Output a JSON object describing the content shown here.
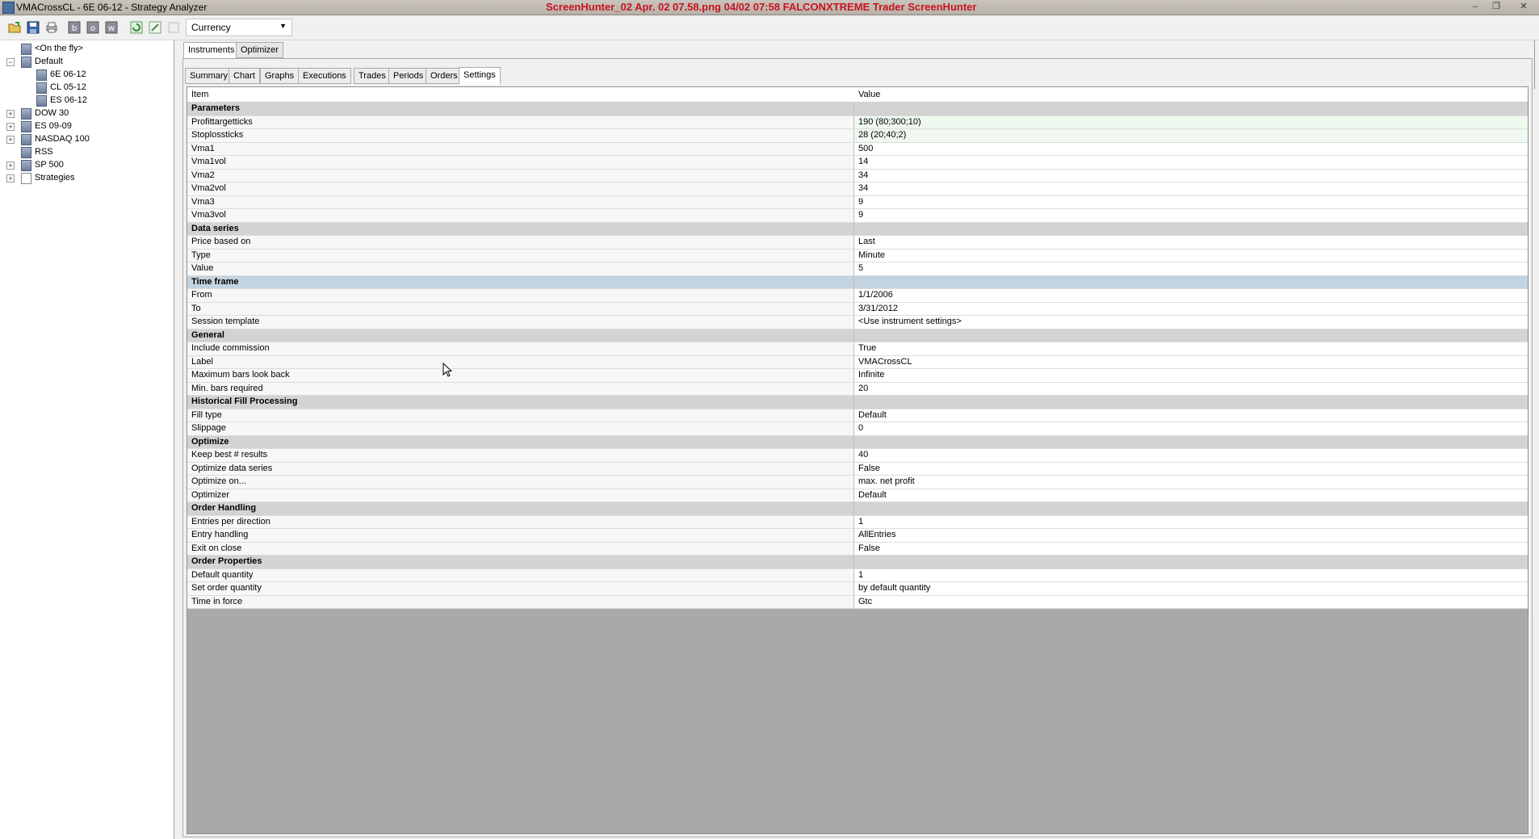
{
  "titlebar": {
    "title": "VMACrossCL - 6E 06-12 - Strategy Analyzer",
    "center_text": "ScreenHunter_02 Apr. 02 07.58.png   04/02  07:58  FALCONXTREME  Trader  ScreenHunter",
    "minimize": "‒",
    "restore": "❐",
    "close": "✕"
  },
  "toolbar": {
    "currency": "Currency",
    "buttons": [
      "open-icon",
      "save-icon",
      "print-icon",
      "b-icon",
      "o-icon",
      "w-icon",
      "refresh-icon",
      "tool-icon",
      "disabled-icon"
    ]
  },
  "tree": [
    {
      "label": "<On the fly>",
      "expander": "",
      "level": 0
    },
    {
      "label": "Default",
      "expander": "−",
      "level": 0
    },
    {
      "label": "6E 06-12",
      "expander": "",
      "level": 1
    },
    {
      "label": "CL 05-12",
      "expander": "",
      "level": 1
    },
    {
      "label": "ES 06-12",
      "expander": "",
      "level": 1
    },
    {
      "label": "DOW 30",
      "expander": "+",
      "level": 0
    },
    {
      "label": "ES 09-09",
      "expander": "+",
      "level": 0
    },
    {
      "label": "NASDAQ 100",
      "expander": "+",
      "level": 0
    },
    {
      "label": "RSS",
      "expander": "",
      "level": 0
    },
    {
      "label": "SP 500",
      "expander": "+",
      "level": 0
    },
    {
      "label": "Strategies",
      "expander": "+",
      "level": 0
    }
  ],
  "top_tabs": [
    "Instruments",
    "Optimizer"
  ],
  "sub_tabs": [
    "Summary",
    "Chart",
    "Graphs",
    "Executions",
    "Trades",
    "Periods",
    "Orders",
    "Settings"
  ],
  "grid": {
    "col_item": "Item",
    "col_value": "Value",
    "rows": [
      {
        "type": "cat",
        "item": "Parameters",
        "value": ""
      },
      {
        "type": "prop",
        "item": "Profittargetticks",
        "value": "190 (80;300;10)",
        "green": true
      },
      {
        "type": "prop",
        "item": "Stoplossticks",
        "value": "28 (20;40;2)",
        "green": true
      },
      {
        "type": "prop",
        "item": "Vma1",
        "value": "500"
      },
      {
        "type": "prop",
        "item": "Vma1vol",
        "value": "14"
      },
      {
        "type": "prop",
        "item": "Vma2",
        "value": "34"
      },
      {
        "type": "prop",
        "item": "Vma2vol",
        "value": "34"
      },
      {
        "type": "prop",
        "item": "Vma3",
        "value": "9"
      },
      {
        "type": "prop",
        "item": "Vma3vol",
        "value": "9"
      },
      {
        "type": "cat",
        "item": "Data series",
        "value": ""
      },
      {
        "type": "prop",
        "item": "Price based on",
        "value": "Last"
      },
      {
        "type": "prop",
        "item": "Type",
        "value": "Minute"
      },
      {
        "type": "prop",
        "item": "Value",
        "value": "5"
      },
      {
        "type": "cat",
        "item": "Time frame",
        "value": "",
        "selected": true
      },
      {
        "type": "prop",
        "item": "From",
        "value": "1/1/2006"
      },
      {
        "type": "prop",
        "item": "To",
        "value": "3/31/2012"
      },
      {
        "type": "prop",
        "item": "Session template",
        "value": "<Use instrument settings>"
      },
      {
        "type": "cat",
        "item": "General",
        "value": ""
      },
      {
        "type": "prop",
        "item": "Include commission",
        "value": "True"
      },
      {
        "type": "prop",
        "item": "Label",
        "value": "VMACrossCL"
      },
      {
        "type": "prop",
        "item": "Maximum bars look back",
        "value": "Infinite"
      },
      {
        "type": "prop",
        "item": "Min. bars required",
        "value": "20"
      },
      {
        "type": "cat",
        "item": "Historical Fill Processing",
        "value": ""
      },
      {
        "type": "prop",
        "item": "Fill type",
        "value": "Default"
      },
      {
        "type": "prop",
        "item": "Slippage",
        "value": "0"
      },
      {
        "type": "cat",
        "item": "Optimize",
        "value": ""
      },
      {
        "type": "prop",
        "item": "Keep best # results",
        "value": "40"
      },
      {
        "type": "prop",
        "item": "Optimize data series",
        "value": "False"
      },
      {
        "type": "prop",
        "item": "Optimize on...",
        "value": "max. net profit"
      },
      {
        "type": "prop",
        "item": "Optimizer",
        "value": "Default"
      },
      {
        "type": "cat",
        "item": "Order Handling",
        "value": ""
      },
      {
        "type": "prop",
        "item": "Entries per direction",
        "value": "1"
      },
      {
        "type": "prop",
        "item": "Entry handling",
        "value": "AllEntries"
      },
      {
        "type": "prop",
        "item": "Exit on close",
        "value": "False"
      },
      {
        "type": "cat",
        "item": "Order Properties",
        "value": ""
      },
      {
        "type": "prop",
        "item": "Default quantity",
        "value": "1"
      },
      {
        "type": "prop",
        "item": "Set order quantity",
        "value": "by default quantity"
      },
      {
        "type": "prop",
        "item": "Time in force",
        "value": "Gtc"
      }
    ]
  }
}
